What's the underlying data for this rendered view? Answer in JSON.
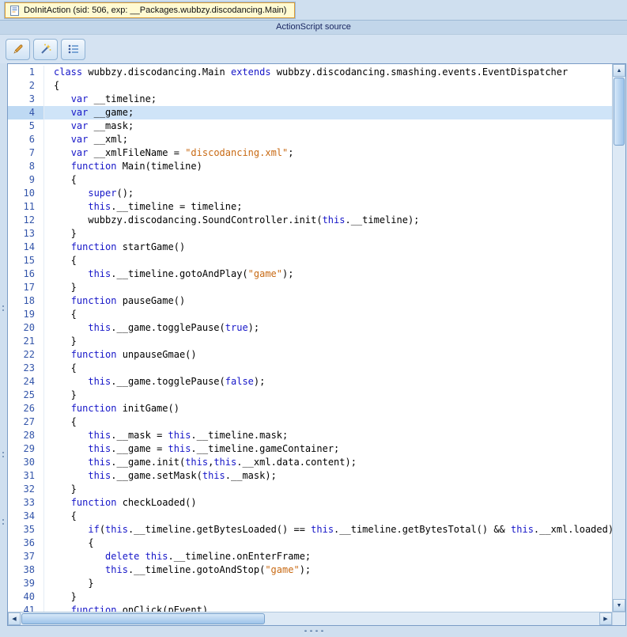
{
  "tab": {
    "icon": "script-icon",
    "title": "DoInitAction (sid: 506, exp: __Packages.wubbzy.discodancing.Main)"
  },
  "panel_header": {
    "label": "ActionScript source"
  },
  "toolbar": {
    "buttons": [
      {
        "name": "edit-button",
        "icon": "pencil-icon"
      },
      {
        "name": "magic-wand-button",
        "icon": "magic-wand-icon"
      },
      {
        "name": "list-button",
        "icon": "list-icon"
      }
    ]
  },
  "editor": {
    "language": "ActionScript",
    "active_line": 4,
    "lines": [
      [
        [
          "k",
          "class"
        ],
        [
          "p",
          " wubbzy.discodancing.Main "
        ],
        [
          "k",
          "extends"
        ],
        [
          "p",
          " wubbzy.discodancing.smashing.events.EventDispatcher"
        ]
      ],
      [
        [
          "p",
          "{"
        ]
      ],
      [
        [
          "p",
          "   "
        ],
        [
          "k",
          "var"
        ],
        [
          "p",
          " __timeline;"
        ]
      ],
      [
        [
          "p",
          "   "
        ],
        [
          "k",
          "var"
        ],
        [
          "p",
          " __game;"
        ]
      ],
      [
        [
          "p",
          "   "
        ],
        [
          "k",
          "var"
        ],
        [
          "p",
          " __mask;"
        ]
      ],
      [
        [
          "p",
          "   "
        ],
        [
          "k",
          "var"
        ],
        [
          "p",
          " __xml;"
        ]
      ],
      [
        [
          "p",
          "   "
        ],
        [
          "k",
          "var"
        ],
        [
          "p",
          " __xmlFileName = "
        ],
        [
          "s",
          "\"discodancing.xml\""
        ],
        [
          "p",
          ";"
        ]
      ],
      [
        [
          "p",
          "   "
        ],
        [
          "k",
          "function"
        ],
        [
          "p",
          " Main(timeline)"
        ]
      ],
      [
        [
          "p",
          "   {"
        ]
      ],
      [
        [
          "p",
          "      "
        ],
        [
          "k",
          "super"
        ],
        [
          "p",
          "();"
        ]
      ],
      [
        [
          "p",
          "      "
        ],
        [
          "k",
          "this"
        ],
        [
          "p",
          ".__timeline = timeline;"
        ]
      ],
      [
        [
          "p",
          "      wubbzy.discodancing.SoundController.init("
        ],
        [
          "k",
          "this"
        ],
        [
          "p",
          ".__timeline);"
        ]
      ],
      [
        [
          "p",
          "   }"
        ]
      ],
      [
        [
          "p",
          "   "
        ],
        [
          "k",
          "function"
        ],
        [
          "p",
          " startGame()"
        ]
      ],
      [
        [
          "p",
          "   {"
        ]
      ],
      [
        [
          "p",
          "      "
        ],
        [
          "k",
          "this"
        ],
        [
          "p",
          ".__timeline.gotoAndPlay("
        ],
        [
          "s",
          "\"game\""
        ],
        [
          "p",
          ");"
        ]
      ],
      [
        [
          "p",
          "   }"
        ]
      ],
      [
        [
          "p",
          "   "
        ],
        [
          "k",
          "function"
        ],
        [
          "p",
          " pauseGame()"
        ]
      ],
      [
        [
          "p",
          "   {"
        ]
      ],
      [
        [
          "p",
          "      "
        ],
        [
          "k",
          "this"
        ],
        [
          "p",
          ".__game.togglePause("
        ],
        [
          "k",
          "true"
        ],
        [
          "p",
          ");"
        ]
      ],
      [
        [
          "p",
          "   }"
        ]
      ],
      [
        [
          "p",
          "   "
        ],
        [
          "k",
          "function"
        ],
        [
          "p",
          " unpauseGmae()"
        ]
      ],
      [
        [
          "p",
          "   {"
        ]
      ],
      [
        [
          "p",
          "      "
        ],
        [
          "k",
          "this"
        ],
        [
          "p",
          ".__game.togglePause("
        ],
        [
          "k",
          "false"
        ],
        [
          "p",
          ");"
        ]
      ],
      [
        [
          "p",
          "   }"
        ]
      ],
      [
        [
          "p",
          "   "
        ],
        [
          "k",
          "function"
        ],
        [
          "p",
          " initGame()"
        ]
      ],
      [
        [
          "p",
          "   {"
        ]
      ],
      [
        [
          "p",
          "      "
        ],
        [
          "k",
          "this"
        ],
        [
          "p",
          ".__mask = "
        ],
        [
          "k",
          "this"
        ],
        [
          "p",
          ".__timeline.mask;"
        ]
      ],
      [
        [
          "p",
          "      "
        ],
        [
          "k",
          "this"
        ],
        [
          "p",
          ".__game = "
        ],
        [
          "k",
          "this"
        ],
        [
          "p",
          ".__timeline.gameContainer;"
        ]
      ],
      [
        [
          "p",
          "      "
        ],
        [
          "k",
          "this"
        ],
        [
          "p",
          ".__game.init("
        ],
        [
          "k",
          "this"
        ],
        [
          "p",
          ","
        ],
        [
          "k",
          "this"
        ],
        [
          "p",
          ".__xml.data.content);"
        ]
      ],
      [
        [
          "p",
          "      "
        ],
        [
          "k",
          "this"
        ],
        [
          "p",
          ".__game.setMask("
        ],
        [
          "k",
          "this"
        ],
        [
          "p",
          ".__mask);"
        ]
      ],
      [
        [
          "p",
          "   }"
        ]
      ],
      [
        [
          "p",
          "   "
        ],
        [
          "k",
          "function"
        ],
        [
          "p",
          " checkLoaded()"
        ]
      ],
      [
        [
          "p",
          "   {"
        ]
      ],
      [
        [
          "p",
          "      "
        ],
        [
          "k",
          "if"
        ],
        [
          "p",
          "("
        ],
        [
          "k",
          "this"
        ],
        [
          "p",
          ".__timeline.getBytesLoaded() == "
        ],
        [
          "k",
          "this"
        ],
        [
          "p",
          ".__timeline.getBytesTotal() && "
        ],
        [
          "k",
          "this"
        ],
        [
          "p",
          ".__xml.loaded)"
        ]
      ],
      [
        [
          "p",
          "      {"
        ]
      ],
      [
        [
          "p",
          "         "
        ],
        [
          "k",
          "delete"
        ],
        [
          "p",
          " "
        ],
        [
          "k",
          "this"
        ],
        [
          "p",
          ".__timeline.onEnterFrame;"
        ]
      ],
      [
        [
          "p",
          "         "
        ],
        [
          "k",
          "this"
        ],
        [
          "p",
          ".__timeline.gotoAndStop("
        ],
        [
          "s",
          "\"game\""
        ],
        [
          "p",
          ");"
        ]
      ],
      [
        [
          "p",
          "      }"
        ]
      ],
      [
        [
          "p",
          "   }"
        ]
      ],
      [
        [
          "p",
          "   "
        ],
        [
          "k",
          "function"
        ],
        [
          "p",
          " onClick(pEvent)"
        ]
      ]
    ]
  },
  "scroll_state": {
    "vertical_thumb_at_top": true,
    "horizontal_thumb_at_left": true
  },
  "colors": {
    "keyword": "#1616c8",
    "string": "#c86a14",
    "plain": "#000000",
    "line_number": "#3355aa",
    "active_line_bg": "#cfe4f8",
    "window_bg": "#cfdfef",
    "panel_header_bg": "#c2d6ea",
    "tab_bg": "#fffad2",
    "tab_border": "#dc9c34"
  }
}
